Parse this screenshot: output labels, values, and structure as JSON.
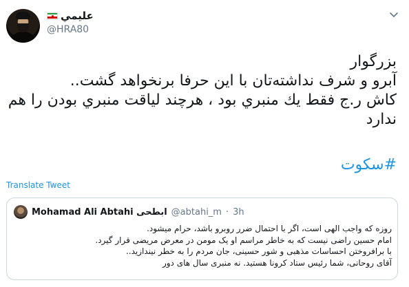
{
  "author": {
    "display_name": "علیمي",
    "handle": "@HRA80",
    "flag_icon": "iran-flag-icon"
  },
  "tweet": {
    "lines": [
      "بزرگوار",
      "آبرو و شرف نداشته‌تان با این حرفا برنخواهد گشت..",
      "كاش ر.ج فقط يك منبري بود ، هرچند لياقت منبري بودن را هم",
      "ندارد"
    ],
    "hashtag": "#سکوت",
    "translate_label": "Translate Tweet"
  },
  "quoted": {
    "display_name": "Mohamad Ali Abtahi ابطحی",
    "handle": "@abtahi_m",
    "separator": "·",
    "time": "3h",
    "lines": [
      "روزه که واجب الهی است، اگر با  احتمال ضرر روبرو باشد، حرام میشود.",
      "امام حسین راضی نیست که به خاطر مراسم او یک مومن در معرض مریضی قرار گیرد.",
      "با برافروختن احساسات مذهبی و شور حسینی، جان مردم را به خطر نیندازید..",
      "آقای روحانی، شما رئیس ستاد کرونا هستید. نه منبری سال های دور"
    ]
  },
  "colors": {
    "link": "#1b95e0",
    "secondary_text": "#657786",
    "border": "#ccd6dd"
  }
}
